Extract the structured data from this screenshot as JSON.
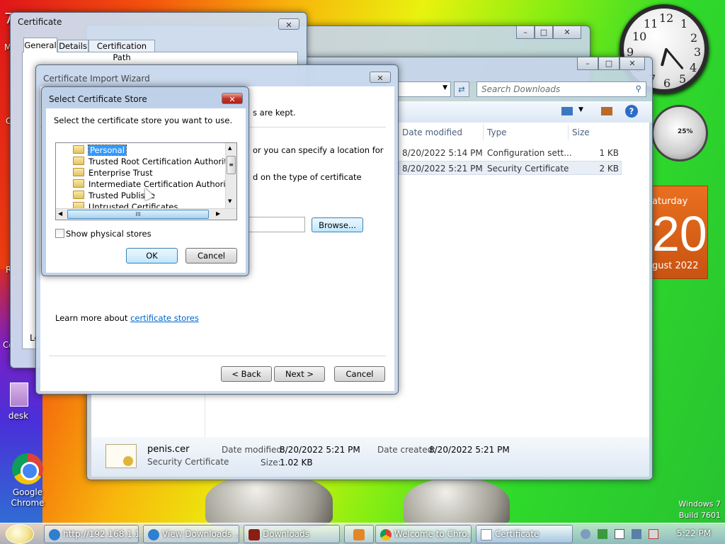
{
  "desktop": {
    "chrome_icon_label": "Google Chrome",
    "desk_icon_label": "desk",
    "watermark": [
      "Windows 7",
      "Build 7601"
    ],
    "calendar": {
      "day": "aturday",
      "date": "20",
      "month": "gust 2022"
    },
    "meter_percent": "25%"
  },
  "clock_numbers": [
    "12",
    "1",
    "2",
    "3",
    "4",
    "5",
    "6",
    "7",
    "8",
    "9",
    "10",
    "11"
  ],
  "certificate_window": {
    "title": "Certificate",
    "tabs": [
      "General",
      "Details",
      "Certification Path"
    ],
    "left_label_fragment": "Le"
  },
  "explorer_window": {
    "search_placeholder": "Search Downloads",
    "columns": [
      "Date modified",
      "Type",
      "Size"
    ],
    "rows": [
      {
        "date": "8/20/2022 5:14 PM",
        "type": "Configuration sett...",
        "size": "1 KB"
      },
      {
        "date": "8/20/2022 5:21 PM",
        "type": "Security Certificate",
        "size": "2 KB"
      }
    ],
    "details": {
      "name": "penis.cer",
      "kind": "Security Certificate",
      "modified_label": "Date modified:",
      "modified": "8/20/2022 5:21 PM",
      "created_label": "Date created:",
      "created": "8/20/2022 5:21 PM",
      "size_label": "Size:",
      "size": "1.02 KB"
    }
  },
  "wizard": {
    "title": "Certificate Import Wizard",
    "text_kept": "s are kept.",
    "text_location": "or you can specify a location for",
    "text_type": "d on the type of certificate",
    "browse_label": "Browse...",
    "learn_more_prefix": "Learn more about ",
    "learn_more_link": "certificate stores",
    "back_label": "< Back",
    "next_label": "Next >",
    "cancel_label": "Cancel"
  },
  "store_dialog": {
    "title": "Select Certificate Store",
    "instruction": "Select the certificate store you want to use.",
    "stores": [
      "Personal",
      "Trusted Root Certification Authorities",
      "Enterprise Trust",
      "Intermediate Certification Authorities",
      "Trusted Publishe",
      "Untrusted Certificates"
    ],
    "selected_index": 0,
    "show_physical_label": "Show physical stores",
    "show_physical_checked": false,
    "ok_label": "OK",
    "cancel_label": "Cancel",
    "hscroll_grip": "III"
  },
  "taskbar": {
    "items": [
      {
        "label": "http://192.168.1.1...",
        "icon": "ie-icon",
        "color": "#2f7fd1"
      },
      {
        "label": "View Downloads ...",
        "icon": "ie-icon",
        "color": "#2f7fd1"
      },
      {
        "label": "Downloads",
        "icon": "downloads-icon",
        "color": "#8a1e12"
      },
      {
        "label": "",
        "icon": "media-player-icon",
        "color": "#e3862a"
      },
      {
        "label": "Welcome to Chro...",
        "icon": "chrome-icon",
        "color": "#db4437"
      },
      {
        "label": "Certificate",
        "icon": "certificate-icon",
        "color": "#ffffff"
      }
    ],
    "time": "5:22 PM"
  }
}
